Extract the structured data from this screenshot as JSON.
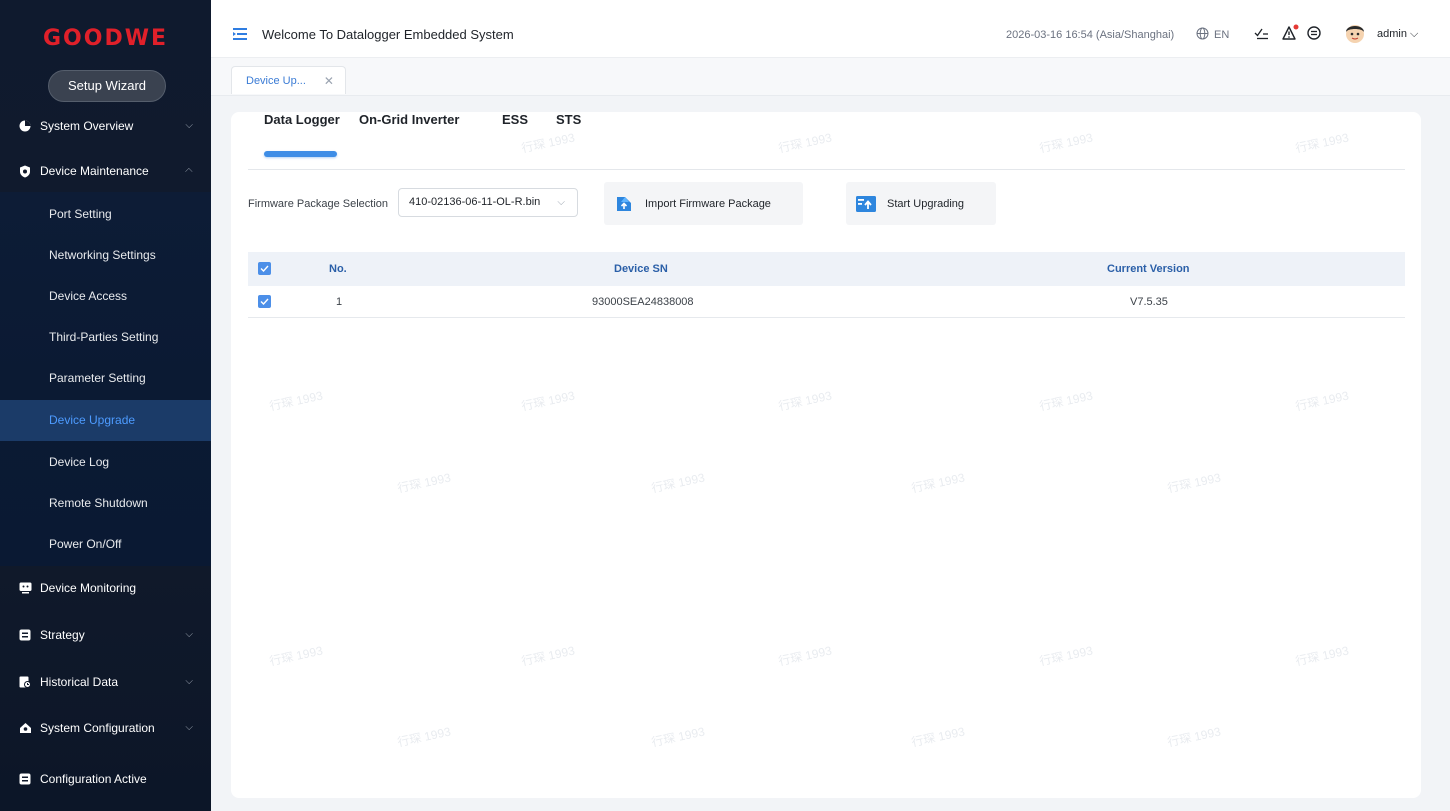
{
  "sidebar": {
    "logo": "GOODWE",
    "setup_wizard": "Setup Wizard",
    "groups": [
      {
        "label": "System Overview",
        "icon": "pie-icon"
      },
      {
        "label": "Device Maintenance",
        "icon": "shield-icon"
      },
      {
        "label": "Device Monitoring",
        "icon": "monitor-icon"
      },
      {
        "label": "Strategy",
        "icon": "strategy-icon"
      },
      {
        "label": "Historical Data",
        "icon": "history-icon"
      },
      {
        "label": "System Configuration",
        "icon": "config-icon"
      },
      {
        "label": "Configuration Active",
        "icon": "config-active-icon"
      }
    ],
    "sub_items": [
      "Port Setting",
      "Networking Settings",
      "Device Access",
      "Third-Parties Setting",
      "Parameter Setting",
      "Device Upgrade",
      "Device Log",
      "Remote Shutdown",
      "Power On/Off"
    ],
    "active_sub": "Device Upgrade"
  },
  "header": {
    "welcome": "Welcome To Datalogger Embedded System",
    "datetime": "2026-03-16 16:54 (Asia/Shanghai)",
    "language": "EN",
    "user": "admin"
  },
  "page_tabs": [
    {
      "label": "Device Up..."
    }
  ],
  "content": {
    "tabs": [
      "Data Logger",
      "On-Grid Inverter",
      "ESS",
      "STS"
    ],
    "active_tab": "Data Logger",
    "firmware_label": "Firmware Package Selection",
    "firmware_value": "410-02136-06-11-OL-R.bin",
    "import_button": "Import Firmware Package",
    "start_button": "Start Upgrading",
    "table": {
      "columns": [
        "No.",
        "Device SN",
        "Current Version"
      ],
      "rows": [
        {
          "no": "1",
          "sn": "93000SEA24838008",
          "version": "V7.5.35",
          "checked": true
        }
      ],
      "header_checked": true
    }
  },
  "watermark": "行琛 1993",
  "colors": {
    "brand": "#e0202a",
    "accent": "#3e8de6",
    "sidebar_bg": "#111a2b",
    "active_bg": "#1b3b68"
  }
}
